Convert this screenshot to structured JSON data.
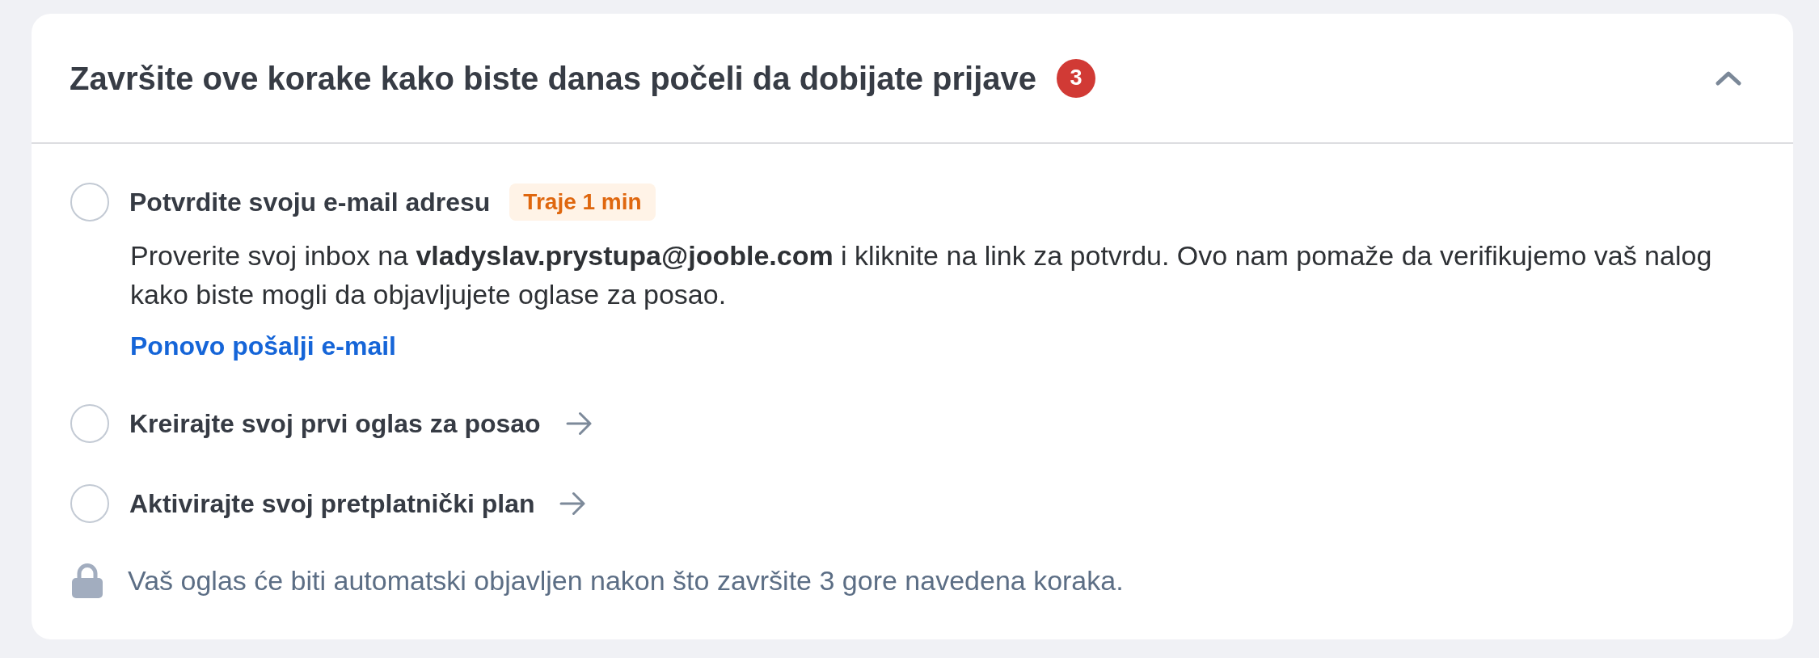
{
  "header": {
    "title": "Završite ove korake kako biste danas počeli da dobijate prijave",
    "badge": "3",
    "expanded": true
  },
  "steps": [
    {
      "kind": "detail",
      "title": "Potvrdite svoju e-mail adresu",
      "checked": false,
      "tag": "Traje 1 min",
      "description": "Proverite svoj inbox na **vladyslav.prystupa@jooble.com** i kliknite na link za potvrdu. Ovo nam pomaže da verifikujemo vaš nalog kako biste mogli da objavljujete oglase za posao.",
      "link": "Ponovo pošalji e-mail"
    },
    {
      "kind": "link",
      "title": "Kreirajte svoj prvi oglas za posao",
      "checked": false
    },
    {
      "kind": "link",
      "title": "Aktivirajte svoj pretplatnički plan",
      "checked": false
    }
  ],
  "footer": {
    "text": "Vaš oglas će biti automatski objavljen nakon što završite 3 gore navedena koraka."
  }
}
